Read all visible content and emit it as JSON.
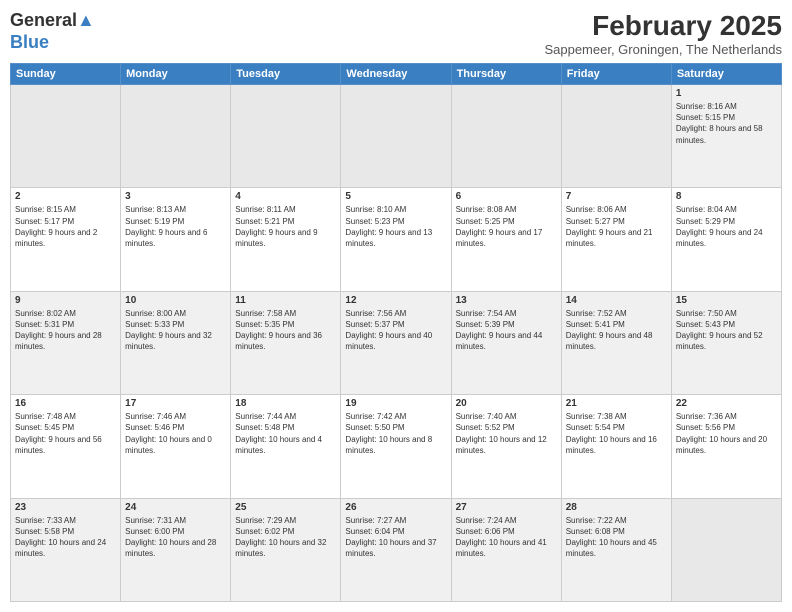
{
  "logo": {
    "line1": "General",
    "line2": "Blue"
  },
  "title": "February 2025",
  "location": "Sappemeer, Groningen, The Netherlands",
  "days": [
    "Sunday",
    "Monday",
    "Tuesday",
    "Wednesday",
    "Thursday",
    "Friday",
    "Saturday"
  ],
  "weeks": [
    [
      {
        "num": "",
        "info": "",
        "empty": true
      },
      {
        "num": "",
        "info": "",
        "empty": true
      },
      {
        "num": "",
        "info": "",
        "empty": true
      },
      {
        "num": "",
        "info": "",
        "empty": true
      },
      {
        "num": "",
        "info": "",
        "empty": true
      },
      {
        "num": "",
        "info": "",
        "empty": true
      },
      {
        "num": "1",
        "info": "Sunrise: 8:16 AM\nSunset: 5:15 PM\nDaylight: 8 hours and 58 minutes.",
        "empty": false
      }
    ],
    [
      {
        "num": "2",
        "info": "Sunrise: 8:15 AM\nSunset: 5:17 PM\nDaylight: 9 hours and 2 minutes.",
        "empty": false
      },
      {
        "num": "3",
        "info": "Sunrise: 8:13 AM\nSunset: 5:19 PM\nDaylight: 9 hours and 6 minutes.",
        "empty": false
      },
      {
        "num": "4",
        "info": "Sunrise: 8:11 AM\nSunset: 5:21 PM\nDaylight: 9 hours and 9 minutes.",
        "empty": false
      },
      {
        "num": "5",
        "info": "Sunrise: 8:10 AM\nSunset: 5:23 PM\nDaylight: 9 hours and 13 minutes.",
        "empty": false
      },
      {
        "num": "6",
        "info": "Sunrise: 8:08 AM\nSunset: 5:25 PM\nDaylight: 9 hours and 17 minutes.",
        "empty": false
      },
      {
        "num": "7",
        "info": "Sunrise: 8:06 AM\nSunset: 5:27 PM\nDaylight: 9 hours and 21 minutes.",
        "empty": false
      },
      {
        "num": "8",
        "info": "Sunrise: 8:04 AM\nSunset: 5:29 PM\nDaylight: 9 hours and 24 minutes.",
        "empty": false
      }
    ],
    [
      {
        "num": "9",
        "info": "Sunrise: 8:02 AM\nSunset: 5:31 PM\nDaylight: 9 hours and 28 minutes.",
        "empty": false
      },
      {
        "num": "10",
        "info": "Sunrise: 8:00 AM\nSunset: 5:33 PM\nDaylight: 9 hours and 32 minutes.",
        "empty": false
      },
      {
        "num": "11",
        "info": "Sunrise: 7:58 AM\nSunset: 5:35 PM\nDaylight: 9 hours and 36 minutes.",
        "empty": false
      },
      {
        "num": "12",
        "info": "Sunrise: 7:56 AM\nSunset: 5:37 PM\nDaylight: 9 hours and 40 minutes.",
        "empty": false
      },
      {
        "num": "13",
        "info": "Sunrise: 7:54 AM\nSunset: 5:39 PM\nDaylight: 9 hours and 44 minutes.",
        "empty": false
      },
      {
        "num": "14",
        "info": "Sunrise: 7:52 AM\nSunset: 5:41 PM\nDaylight: 9 hours and 48 minutes.",
        "empty": false
      },
      {
        "num": "15",
        "info": "Sunrise: 7:50 AM\nSunset: 5:43 PM\nDaylight: 9 hours and 52 minutes.",
        "empty": false
      }
    ],
    [
      {
        "num": "16",
        "info": "Sunrise: 7:48 AM\nSunset: 5:45 PM\nDaylight: 9 hours and 56 minutes.",
        "empty": false
      },
      {
        "num": "17",
        "info": "Sunrise: 7:46 AM\nSunset: 5:46 PM\nDaylight: 10 hours and 0 minutes.",
        "empty": false
      },
      {
        "num": "18",
        "info": "Sunrise: 7:44 AM\nSunset: 5:48 PM\nDaylight: 10 hours and 4 minutes.",
        "empty": false
      },
      {
        "num": "19",
        "info": "Sunrise: 7:42 AM\nSunset: 5:50 PM\nDaylight: 10 hours and 8 minutes.",
        "empty": false
      },
      {
        "num": "20",
        "info": "Sunrise: 7:40 AM\nSunset: 5:52 PM\nDaylight: 10 hours and 12 minutes.",
        "empty": false
      },
      {
        "num": "21",
        "info": "Sunrise: 7:38 AM\nSunset: 5:54 PM\nDaylight: 10 hours and 16 minutes.",
        "empty": false
      },
      {
        "num": "22",
        "info": "Sunrise: 7:36 AM\nSunset: 5:56 PM\nDaylight: 10 hours and 20 minutes.",
        "empty": false
      }
    ],
    [
      {
        "num": "23",
        "info": "Sunrise: 7:33 AM\nSunset: 5:58 PM\nDaylight: 10 hours and 24 minutes.",
        "empty": false
      },
      {
        "num": "24",
        "info": "Sunrise: 7:31 AM\nSunset: 6:00 PM\nDaylight: 10 hours and 28 minutes.",
        "empty": false
      },
      {
        "num": "25",
        "info": "Sunrise: 7:29 AM\nSunset: 6:02 PM\nDaylight: 10 hours and 32 minutes.",
        "empty": false
      },
      {
        "num": "26",
        "info": "Sunrise: 7:27 AM\nSunset: 6:04 PM\nDaylight: 10 hours and 37 minutes.",
        "empty": false
      },
      {
        "num": "27",
        "info": "Sunrise: 7:24 AM\nSunset: 6:06 PM\nDaylight: 10 hours and 41 minutes.",
        "empty": false
      },
      {
        "num": "28",
        "info": "Sunrise: 7:22 AM\nSunset: 6:08 PM\nDaylight: 10 hours and 45 minutes.",
        "empty": false
      },
      {
        "num": "",
        "info": "",
        "empty": true
      }
    ]
  ]
}
